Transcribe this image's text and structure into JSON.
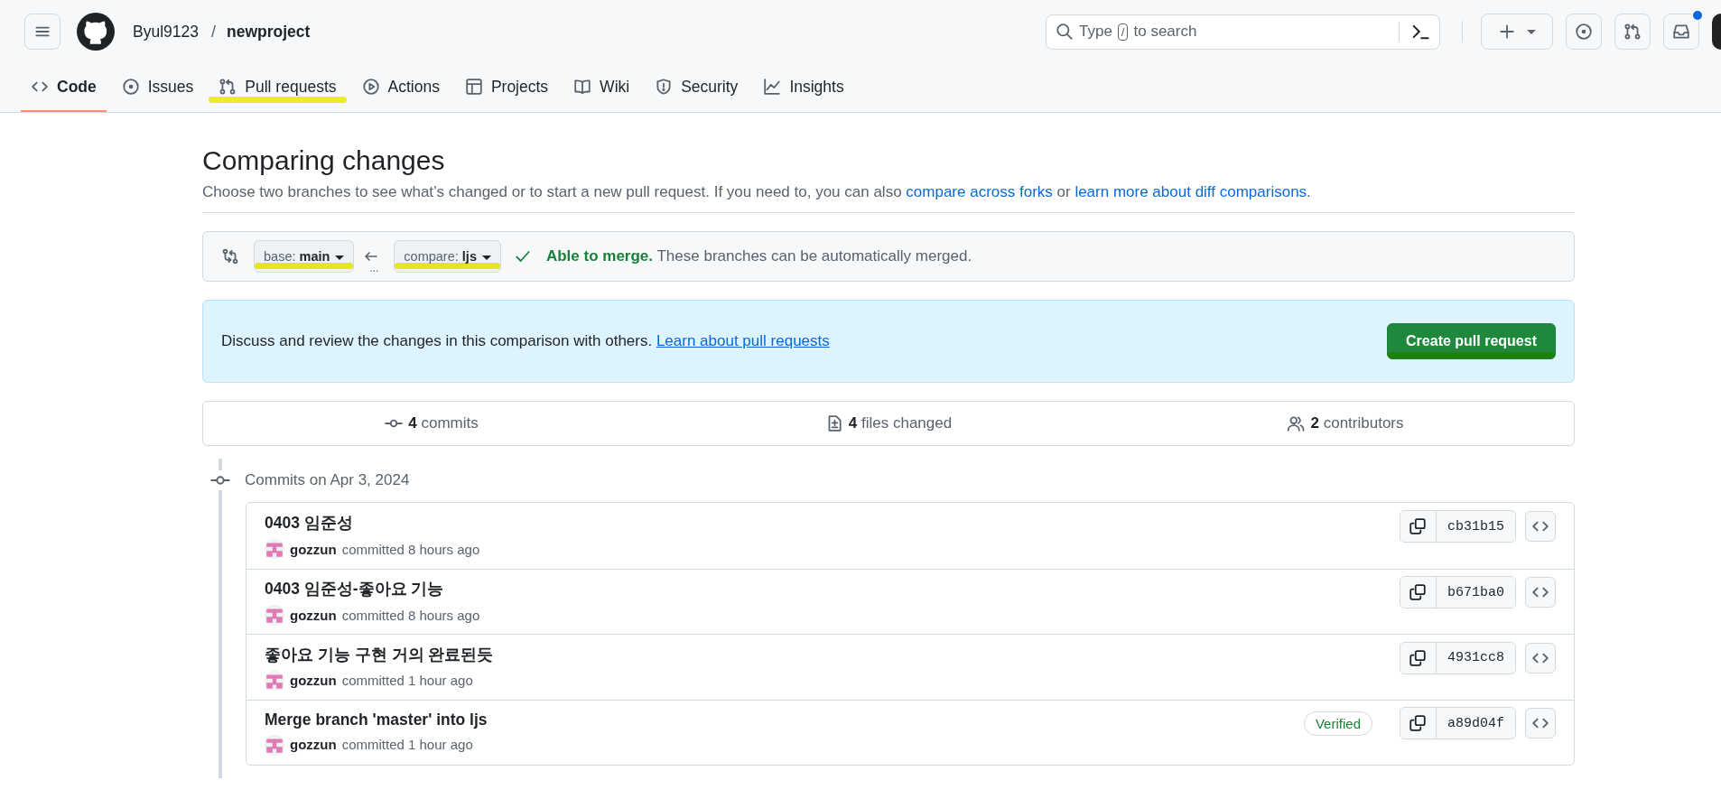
{
  "header": {
    "owner": "Byul9123",
    "separator": "/",
    "repo": "newproject",
    "search": {
      "prefix": "Type",
      "key": "/",
      "suffix": "to search"
    },
    "notification_unread": true
  },
  "tabs": [
    {
      "label": "Code",
      "kind": "code",
      "selected": true,
      "highlighted": false
    },
    {
      "label": "Issues",
      "kind": "issue",
      "selected": false,
      "highlighted": false
    },
    {
      "label": "Pull requests",
      "kind": "pull",
      "selected": false,
      "highlighted": true
    },
    {
      "label": "Actions",
      "kind": "play",
      "selected": false,
      "highlighted": false
    },
    {
      "label": "Projects",
      "kind": "table",
      "selected": false,
      "highlighted": false
    },
    {
      "label": "Wiki",
      "kind": "book",
      "selected": false,
      "highlighted": false
    },
    {
      "label": "Security",
      "kind": "shield",
      "selected": false,
      "highlighted": false
    },
    {
      "label": "Insights",
      "kind": "graph",
      "selected": false,
      "highlighted": false
    }
  ],
  "page": {
    "title": "Comparing changes",
    "description": [
      {
        "kind": "text",
        "text": "Choose two branches to see what’s changed or to start a new pull request. If you need to, you can also "
      },
      {
        "kind": "link",
        "text": "compare across forks"
      },
      {
        "kind": "text",
        "text": " or "
      },
      {
        "kind": "link",
        "text": "learn more about diff comparisons"
      },
      {
        "kind": "text",
        "text": "."
      }
    ]
  },
  "compare_bar": {
    "base": {
      "prefix": "base:",
      "branch": "main",
      "highlighted": true
    },
    "dots": "...",
    "compare": {
      "prefix": "compare:",
      "branch": "ljs",
      "highlighted": true
    },
    "merge": {
      "mergeable": true,
      "title": "Able to merge.",
      "message": "These branches can be automatically merged."
    }
  },
  "banner": {
    "text": "Discuss and review the changes in this comparison with others.",
    "link": "Learn about pull requests",
    "button": {
      "label": "Create pull request",
      "highlighted": true
    }
  },
  "stats": [
    {
      "kind": "commits",
      "count": "4",
      "label": "commits"
    },
    {
      "kind": "files",
      "count": "4",
      "label": "files changed"
    },
    {
      "kind": "contributors",
      "count": "2",
      "label": "contributors"
    }
  ],
  "commit_group": {
    "title": "Commits on Apr 3, 2024",
    "commits": [
      {
        "message": "0403 임준성",
        "author": "gozzun",
        "meta": "committed 8 hours ago",
        "sha": "cb31b15"
      },
      {
        "message": "0403 임준성-좋아요 기능",
        "author": "gozzun",
        "meta": "committed 8 hours ago",
        "sha": "b671ba0"
      },
      {
        "message": "좋아요 기능 구현 거의 완료된듯",
        "author": "gozzun",
        "meta": "committed 1 hour ago",
        "sha": "4931cc8"
      },
      {
        "message": "Merge branch 'master' into ljs",
        "author": "gozzun",
        "meta": "committed 1 hour ago",
        "sha": "a89d04f",
        "badge": "Verified"
      }
    ]
  }
}
